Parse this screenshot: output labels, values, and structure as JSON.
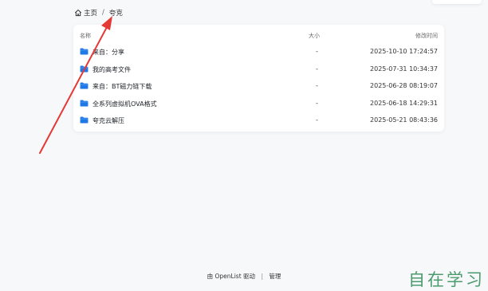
{
  "breadcrumb": {
    "home_label": "主页",
    "separator": "/",
    "current": "夸克"
  },
  "list": {
    "headers": {
      "name": "名称",
      "size": "大小",
      "modified": "修改时间"
    },
    "rows": [
      {
        "name": "来自：分享",
        "size": "-",
        "modified": "2025-10-10 17:24:57"
      },
      {
        "name": "我的高考文件",
        "size": "-",
        "modified": "2025-07-31 10:34:37"
      },
      {
        "name": "来自：BT磁力链下载",
        "size": "-",
        "modified": "2025-06-28 08:19:07"
      },
      {
        "name": "全系列虚拟机OVA格式",
        "size": "-",
        "modified": "2025-06-18 14:29:31"
      },
      {
        "name": "夸克云解压",
        "size": "-",
        "modified": "2025-05-21 08:43:36"
      }
    ]
  },
  "footer": {
    "powered_by": "由 OpenList 驱动",
    "divider": "|",
    "manage": "管理"
  },
  "watermark": "自在学习",
  "colors": {
    "folder": "#1e78e6",
    "annotation_arrow": "#e53935",
    "watermark": "#2e8b57"
  }
}
